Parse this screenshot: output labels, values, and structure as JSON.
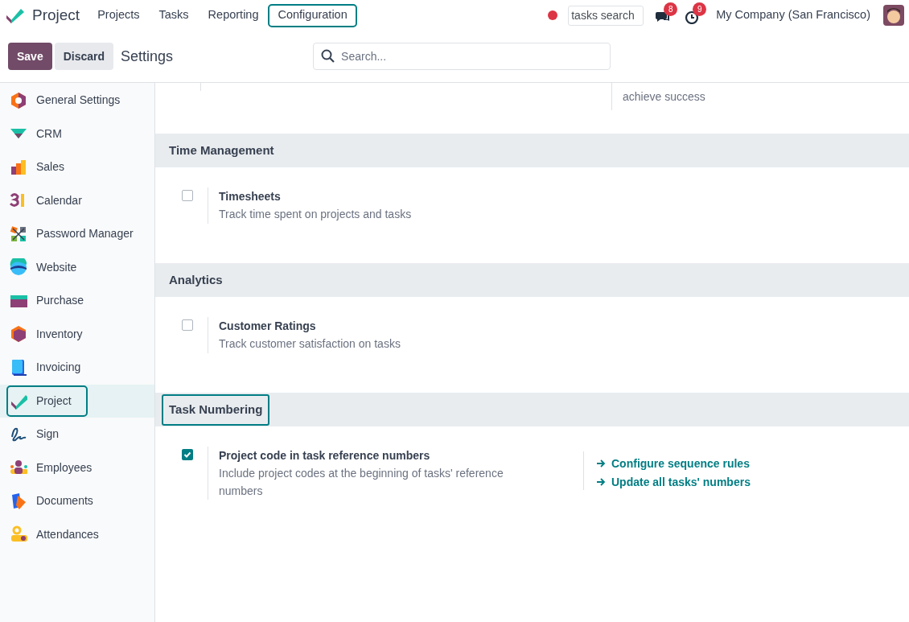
{
  "navbar": {
    "app_name": "Project",
    "menu": [
      {
        "label": "Projects",
        "highlighted": false
      },
      {
        "label": "Tasks",
        "highlighted": false
      },
      {
        "label": "Reporting",
        "highlighted": false
      },
      {
        "label": "Configuration",
        "highlighted": true
      }
    ],
    "search_box": {
      "value": "tasks search"
    },
    "messages_badge": "8",
    "activities_badge": "9",
    "company": "My Company (San Francisco)"
  },
  "control_panel": {
    "buttons": [
      {
        "label": "Save",
        "kind": "primary"
      },
      {
        "label": "Discard",
        "kind": "secondary"
      }
    ],
    "title": "Settings",
    "search": {
      "placeholder": "Search..."
    }
  },
  "sidebar": {
    "items": [
      {
        "label": "General Settings",
        "selected": false,
        "highlighted": false
      },
      {
        "label": "CRM",
        "selected": false,
        "highlighted": false
      },
      {
        "label": "Sales",
        "selected": false,
        "highlighted": false
      },
      {
        "label": "Calendar",
        "selected": false,
        "highlighted": false
      },
      {
        "label": "Password Manager",
        "selected": false,
        "highlighted": false
      },
      {
        "label": "Website",
        "selected": false,
        "highlighted": false
      },
      {
        "label": "Purchase",
        "selected": false,
        "highlighted": false
      },
      {
        "label": "Inventory",
        "selected": false,
        "highlighted": false
      },
      {
        "label": "Invoicing",
        "selected": false,
        "highlighted": false
      },
      {
        "label": "Project",
        "selected": true,
        "highlighted": true
      },
      {
        "label": "Sign",
        "selected": false,
        "highlighted": false
      },
      {
        "label": "Employees",
        "selected": false,
        "highlighted": false
      },
      {
        "label": "Documents",
        "selected": false,
        "highlighted": false
      },
      {
        "label": "Attendances",
        "selected": false,
        "highlighted": false
      }
    ]
  },
  "top_partial": {
    "right_description": "achieve success"
  },
  "sections": [
    {
      "title": "Time Management",
      "highlighted": false,
      "settings": [
        {
          "title": "Timesheets",
          "description": "Track time spent on projects and tasks",
          "checked": false
        }
      ]
    },
    {
      "title": "Analytics",
      "highlighted": false,
      "settings": [
        {
          "title": "Customer Ratings",
          "description": "Track customer satisfaction on tasks",
          "checked": false
        }
      ]
    },
    {
      "title": "Task Numbering",
      "highlighted": true,
      "settings": [
        {
          "title": "Project code in task reference numbers",
          "description": "Include project codes at the beginning of tasks' reference numbers",
          "checked": true,
          "links": [
            "Configure sequence rules",
            "Update all tasks' numbers"
          ]
        }
      ]
    }
  ]
}
